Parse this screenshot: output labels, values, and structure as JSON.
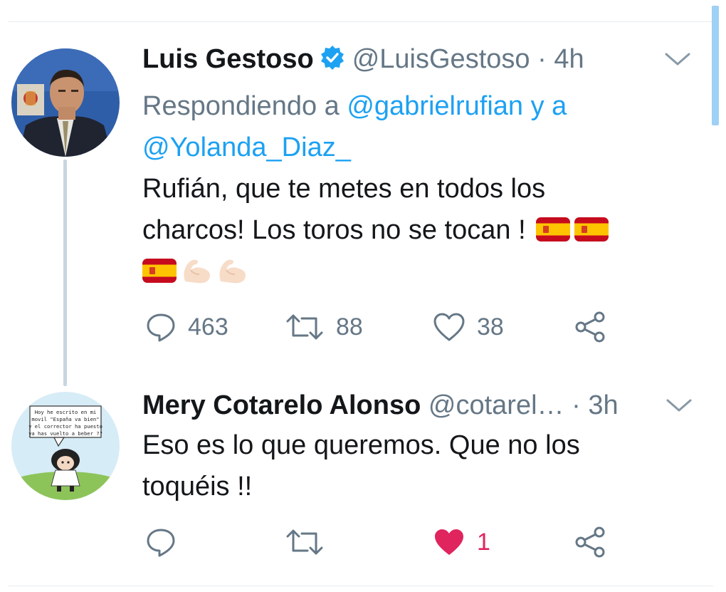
{
  "tweets": [
    {
      "display_name": "Luis Gestoso",
      "handle": "@LuisGestoso",
      "separator": "·",
      "time": "4h",
      "verified": true,
      "replying_prefix": "Respondiendo a",
      "replying_to": [
        "@gabrielrufian",
        "@Yolanda_Diaz_"
      ],
      "replying_joiner": "y a",
      "text_line1": "Rufián, que te metes en todos los",
      "text_line2": "charcos! Los toros no se tocan !",
      "emojis": [
        "spain-flag",
        "spain-flag",
        "spain-flag",
        "flexed-biceps",
        "flexed-biceps"
      ],
      "actions": {
        "reply_count": "463",
        "retweet_count": "88",
        "like_count": "38"
      }
    },
    {
      "display_name": "Mery Cotarelo Alonso",
      "handle": "@cotarel…",
      "separator": "·",
      "time": "3h",
      "verified": false,
      "text_line1": "Eso es lo que queremos. Que no los",
      "text_line2": "toquéis !!",
      "avatar_text": [
        "Hoy he escrito en mi",
        "movil \"España va bien\"",
        "y el corrector ha puesto",
        "ya has vuelto a beber ??"
      ],
      "actions": {
        "reply_count": "",
        "retweet_count": "",
        "like_count": "1",
        "liked": true
      }
    }
  ],
  "colors": {
    "link": "#1da1f2",
    "muted": "#657786",
    "like_active": "#e0245e",
    "thread_line": "#c8d6df",
    "scrollbar": "#9fd0f5"
  },
  "icons": [
    "verified-badge-icon",
    "chevron-down-icon",
    "reply-icon",
    "retweet-icon",
    "like-icon",
    "share-icon"
  ]
}
